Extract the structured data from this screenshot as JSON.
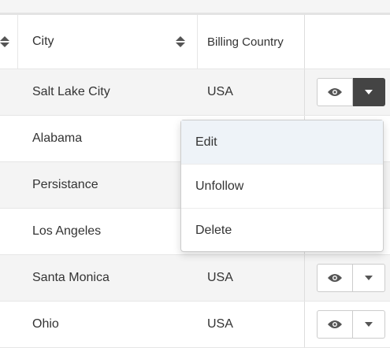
{
  "table": {
    "headers": {
      "city": "City",
      "billing_country": "Billing Country"
    },
    "rows": [
      {
        "city": "Salt Lake City",
        "country": "USA"
      },
      {
        "city": "Alabama",
        "country": ""
      },
      {
        "city": "Persistance",
        "country": ""
      },
      {
        "city": "Los Angeles",
        "country": ""
      },
      {
        "city": "Santa Monica",
        "country": "USA"
      },
      {
        "city": "Ohio",
        "country": "USA"
      }
    ]
  },
  "dropdown": {
    "items": [
      "Edit",
      "Unfollow",
      "Delete"
    ]
  },
  "icons": {
    "view": "eye-icon",
    "menu": "caret-down-icon",
    "sort": "sort-icon"
  },
  "colors": {
    "active_button": "#444444",
    "highlight": "#eef3f8",
    "stripe": "#f4f4f4"
  }
}
